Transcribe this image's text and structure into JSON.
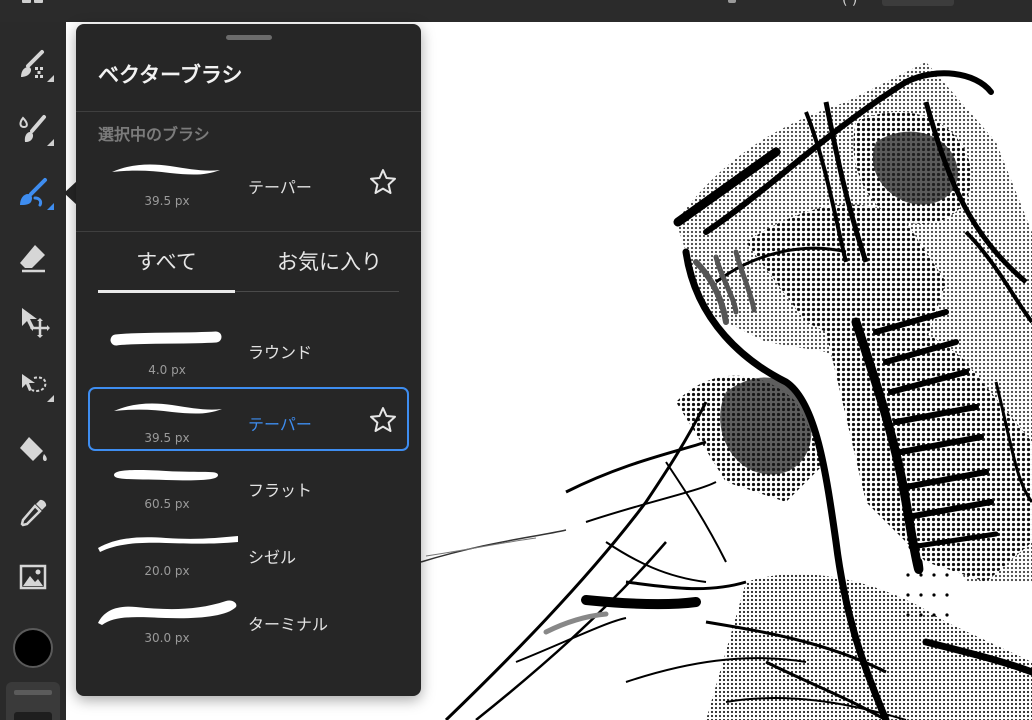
{
  "topbar": {
    "paren_text": "( )"
  },
  "toolbar": {
    "tools": [
      {
        "icon": "pixel-brush-icon"
      },
      {
        "icon": "live-brush-icon"
      },
      {
        "icon": "vector-brush-icon",
        "active": true
      },
      {
        "icon": "eraser-icon"
      },
      {
        "icon": "transform-icon"
      },
      {
        "icon": "lasso-icon"
      },
      {
        "icon": "fill-bucket-icon"
      },
      {
        "icon": "eyedropper-icon"
      },
      {
        "icon": "image-icon"
      }
    ],
    "current_color": "#000000"
  },
  "panel": {
    "title": "ベクターブラシ",
    "current_section_label": "選択中のブラシ",
    "current_brush": {
      "name": "テーパー",
      "size": "39.5 px"
    },
    "tabs": [
      {
        "label": "すべて",
        "active": true
      },
      {
        "label": "お気に入り",
        "active": false
      }
    ],
    "brushes": [
      {
        "name": "ラウンド",
        "size": "4.0 px",
        "selected": false
      },
      {
        "name": "テーパー",
        "size": "39.5 px",
        "selected": true
      },
      {
        "name": "フラット",
        "size": "60.5 px",
        "selected": false
      },
      {
        "name": "シゼル",
        "size": "20.0 px",
        "selected": false
      },
      {
        "name": "ターミナル",
        "size": "30.0 px",
        "selected": false
      }
    ]
  },
  "colors": {
    "accent": "#3e8df0",
    "panel_bg": "#262626",
    "toolbar_bg": "#2a2a2a"
  }
}
